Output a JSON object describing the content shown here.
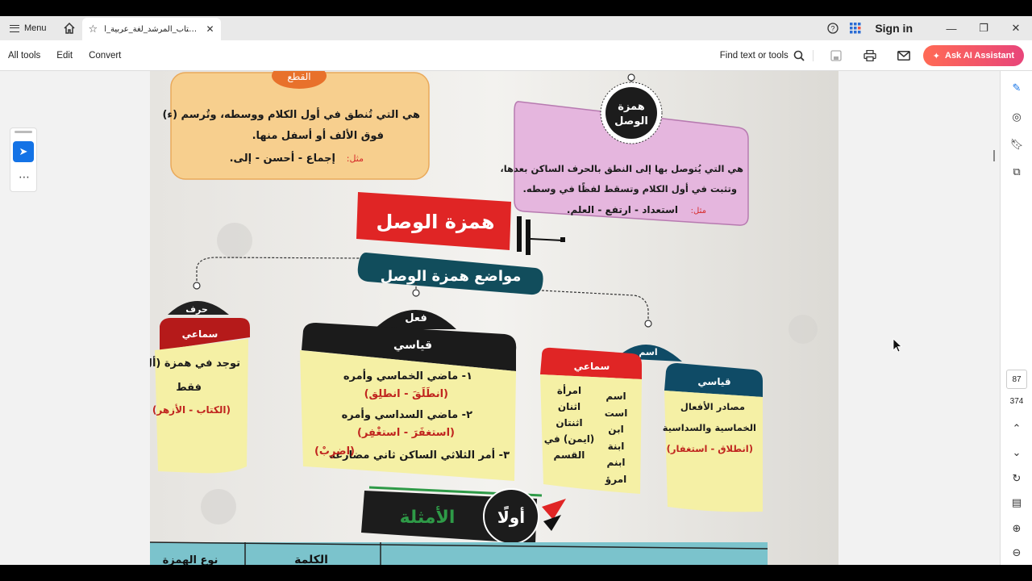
{
  "titlebar": {
    "menu_label": "Menu",
    "tab_title": "كتاب_المرشد_لغة_عربية_أ...",
    "signin_label": "Sign in"
  },
  "toolbar": {
    "all_tools": "All tools",
    "edit": "Edit",
    "convert": "Convert",
    "find": "Find text or tools",
    "ask_ai": "Ask AI Assistant"
  },
  "pager": {
    "current": "87",
    "total": "374"
  },
  "doc": {
    "cut_card": {
      "heading": "القطع",
      "text": "هي التي تُنطق في أول الكلام ووسطه، وتُرسم (ء) فوق الألف أو أسفل منها.",
      "example_label": "مثل:",
      "example": "إجماع - أحسن - إلى."
    },
    "wasl_card": {
      "badge": "همزة الوصل",
      "text": "هي التي يُتوصل بها إلى النطق بالحرف الساكن بعدها، وتثبت في أول الكلام وتسقط لفظًا في وسطه.",
      "example_label": "مثل:",
      "example": "استعداد - ارتفع - العلم."
    },
    "main_title": "همزة الوصل",
    "subtitle": "مواضع همزة الوصل",
    "harf": {
      "tag": "حرف",
      "header": "سماعي",
      "text": "توجد في همزة (أل) فقط",
      "example": "(الكتاب - الأزهر)"
    },
    "fel": {
      "tag": "فعل",
      "header": "قياسي",
      "line1": "١- ماضي الخماسي وأمره",
      "ex1": "(انطَلَقَ - انطلِق)",
      "line2": "٢- ماضي السداسي وأمره",
      "ex2": "(استغفَرَ - استغْفِر)",
      "line3": "٣- أمر الثلاثي الساكن ثاني مضارعه",
      "ex3": "(اضرِبْ)"
    },
    "ism": {
      "tag": "اسم",
      "samai_header": "سماعي",
      "col1": [
        "اسم",
        "است",
        "ابن",
        "ابنة",
        "ابنم",
        "امرؤ"
      ],
      "col2": [
        "امرأة",
        "اثنان",
        "اثنتان",
        "(ايمن) في القسم"
      ],
      "qiyasi_header": "قياسي",
      "qiyasi_text": "مصادر الأفعال الخماسية والسداسية",
      "qiyasi_example": "(انطلاق - استغفار)"
    },
    "examples_title_1": "أولًا",
    "examples_title_2": "الأمثلة",
    "table_headers": [
      "نوع الهمزة",
      "الكلمة"
    ]
  }
}
